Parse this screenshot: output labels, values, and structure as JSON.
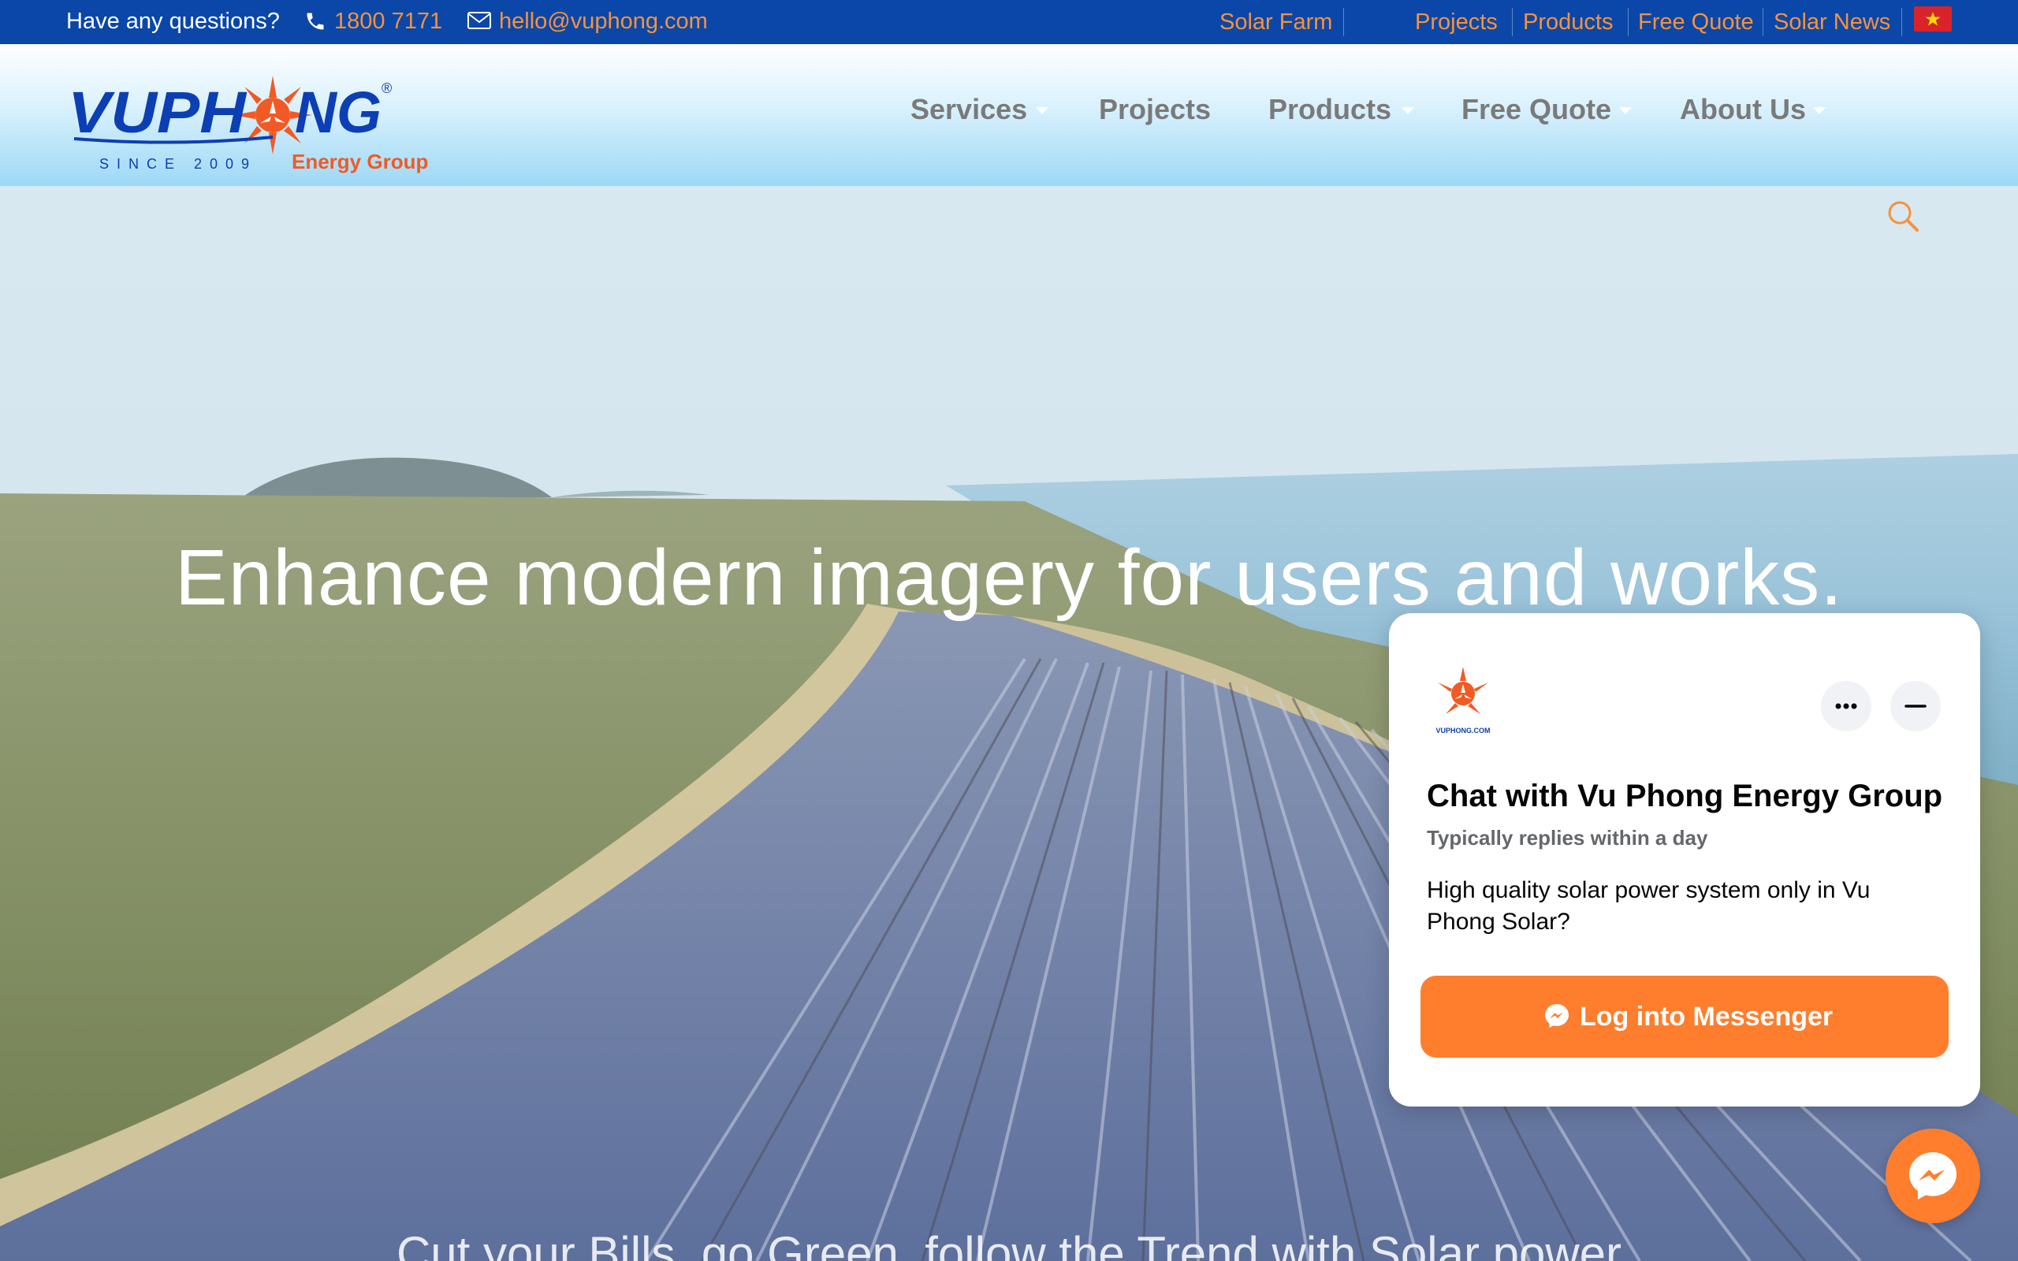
{
  "topbar": {
    "question": "Have any questions?",
    "phone": "1800 7171",
    "email": "hello@vuphong.com",
    "links": [
      "Solar Farm",
      "Projects",
      "Products",
      "Free Quote",
      "Solar News"
    ],
    "phone_icon": "phone-icon",
    "mail_icon": "mail-icon",
    "language_flag": "vietnam-flag-icon",
    "colors": {
      "bar": "#0b47a8",
      "link": "#f7923a"
    }
  },
  "header": {
    "logo": {
      "text": "VUPHONG",
      "registered": "®",
      "since": "SINCE 2009",
      "tagline": "Energy Group"
    },
    "nav": [
      {
        "label": "Services",
        "has_dropdown": true
      },
      {
        "label": "Projects",
        "has_dropdown": false
      },
      {
        "label": "Products",
        "has_dropdown": true
      },
      {
        "label": "Free Quote",
        "has_dropdown": true
      },
      {
        "label": "About Us",
        "has_dropdown": true
      }
    ],
    "search_icon": "search-icon"
  },
  "hero": {
    "title": "Enhance modern imagery for users and works.",
    "subtitle": "Cut your Bills, go Green, follow the Trend with Solar power"
  },
  "chat": {
    "logo_caption": "VUPHONG.COM",
    "title": "Chat with Vu Phong Energy Group",
    "reply_time": "Typically replies within a day",
    "message": "High quality solar power system only in Vu Phong Solar?",
    "login_button": "Log into Messenger",
    "more_icon": "more-icon",
    "minimize_icon": "minimize-icon",
    "messenger_icon": "messenger-icon",
    "accent": "#fe7e2e"
  }
}
